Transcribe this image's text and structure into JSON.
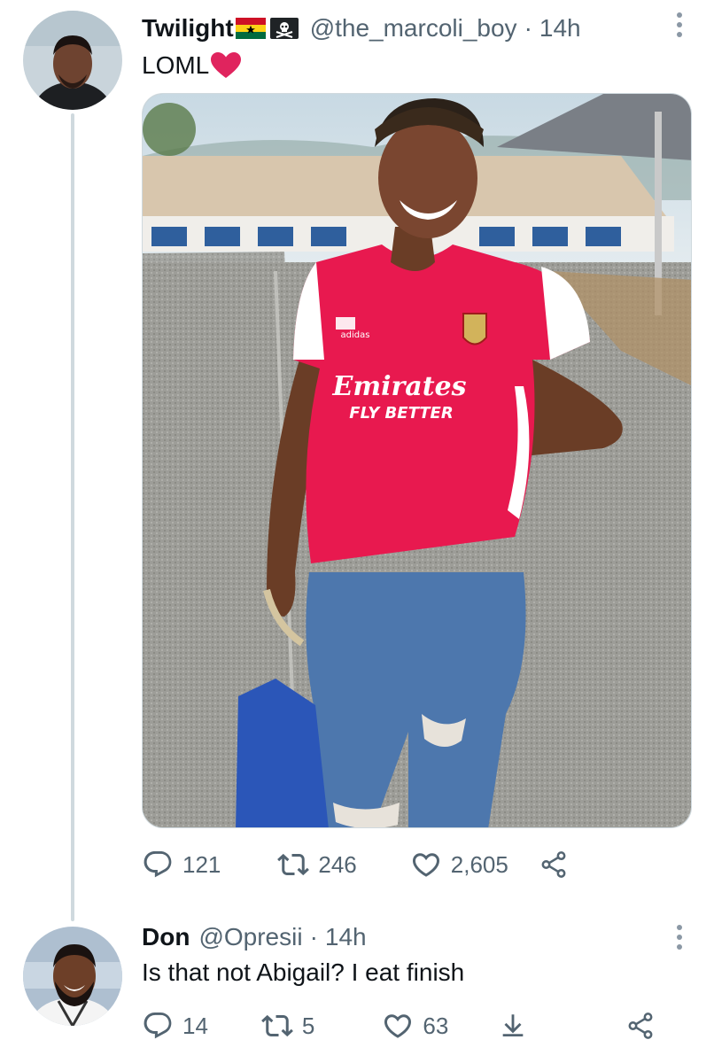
{
  "tweet1": {
    "name": "Twilight",
    "handle": "@the_marcoli_boy",
    "separator": "·",
    "time": "14h",
    "text": "LOML",
    "name_emojis": [
      "ghana-flag-icon",
      "pirate-flag-icon"
    ],
    "text_emoji": "red-heart-icon",
    "photo": {
      "jersey_brand": "Emirates",
      "jersey_slogan": "FLY BETTER",
      "kit_maker": "adidas"
    },
    "stats": {
      "replies": "121",
      "retweets": "246",
      "likes": "2,605"
    }
  },
  "tweet2": {
    "name": "Don",
    "handle": "@Opresii",
    "separator": "·",
    "time": "14h",
    "text": "Is that not Abigail? I eat finish",
    "stats": {
      "replies": "14",
      "retweets": "5",
      "likes": "63"
    }
  },
  "colors": {
    "text_primary": "#0f1419",
    "text_secondary": "#536471",
    "heart_red": "#e0245e",
    "thread_line": "#cfd9de",
    "jersey_red": "#e8194f"
  }
}
